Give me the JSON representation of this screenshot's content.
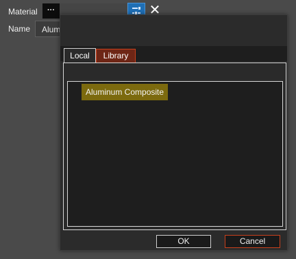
{
  "panel": {
    "material_label": "Material",
    "name_label": "Name",
    "more_button": "···",
    "name_value": "Alum",
    "close_glyph": "✕"
  },
  "dialog": {
    "tabs": [
      {
        "label": "Local",
        "selected": true
      },
      {
        "label": "Library",
        "selected": false
      }
    ],
    "materials": [
      {
        "label": "Aluminum Composite",
        "selected": true
      }
    ],
    "ok_label": "OK",
    "cancel_label": "Cancel"
  },
  "colors": {
    "accent_selection": "#7c6a0e",
    "accent_warning": "#c8401c",
    "picker_blue": "#1f6fb5"
  },
  "icons": {
    "picker": "color-picker-icon",
    "close": "close-icon"
  }
}
